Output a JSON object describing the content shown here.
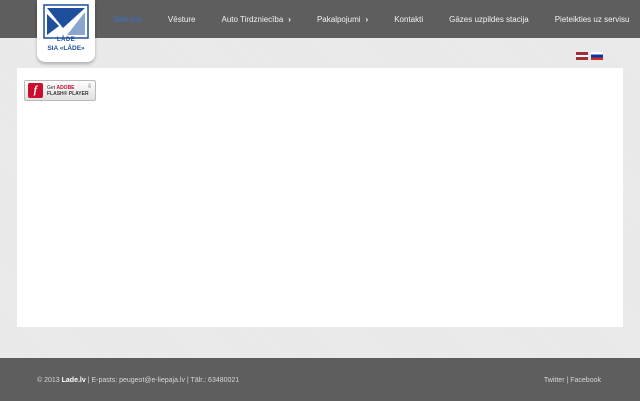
{
  "logo": {
    "name_line": "LĀDE",
    "company_line": "SIA «LĀDE»"
  },
  "nav": {
    "items": [
      {
        "label": "Sākums",
        "active": true,
        "has_submenu": false
      },
      {
        "label": "Vēsture",
        "active": false,
        "has_submenu": false
      },
      {
        "label": "Auto Tirdzniecība",
        "active": false,
        "has_submenu": true
      },
      {
        "label": "Pakalpojumi",
        "active": false,
        "has_submenu": true
      },
      {
        "label": "Kontakti",
        "active": false,
        "has_submenu": false
      },
      {
        "label": "Gāzes uzpildes stacija",
        "active": false,
        "has_submenu": false
      },
      {
        "label": "Pieteikties uz servisu",
        "active": false,
        "has_submenu": false
      }
    ],
    "submenu_arrow": "›"
  },
  "languages": [
    {
      "code": "lv",
      "icon": "flag-latvia-icon"
    },
    {
      "code": "ru",
      "icon": "flag-russia-icon"
    }
  ],
  "flash_badge": {
    "line1_prefix": "Get",
    "line1_brand": "ADOBE",
    "line2": "FLASH® PLAYER",
    "logo_letter": "f",
    "download_glyph": "⇩"
  },
  "footer": {
    "copyright": "© 2013",
    "site": "Lade.lv",
    "email_text": " | E-pasts: peugeot@e-liepaja.lv | Tālr.: 63480021",
    "twitter": "Twitter",
    "separator": " | ",
    "facebook": "Facebook"
  },
  "colors": {
    "bar": "#5e5e5e",
    "active_nav": "#3d6fc6",
    "logo_blue": "#1e4f9c",
    "page_bg": "#ebebeb"
  }
}
